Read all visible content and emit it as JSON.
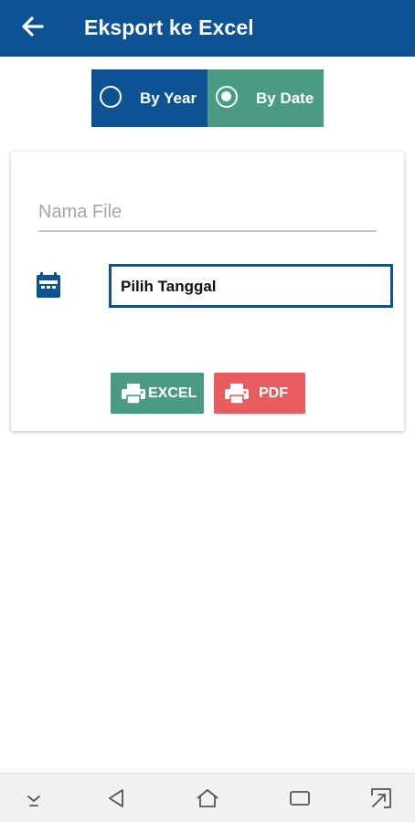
{
  "appbar": {
    "title": "Eksport ke Excel",
    "back_icon": "arrow-left-icon",
    "background": "#0d5394"
  },
  "mode_toggle": {
    "options": [
      {
        "label": "By Year",
        "selected": false
      },
      {
        "label": "By Date",
        "selected": true
      }
    ],
    "colors": {
      "unselected": "#0d5394",
      "selected": "#4a9b84"
    }
  },
  "form": {
    "filename": {
      "placeholder": "Nama File",
      "value": ""
    },
    "date": {
      "icon": "calendar-icon",
      "label": "Pilih Tanggal"
    },
    "buttons": {
      "excel": {
        "label": "EXCEL",
        "icon": "printer-icon",
        "color": "#4a9b84"
      },
      "pdf": {
        "label": "PDF",
        "icon": "printer-icon",
        "color": "#e85d5d"
      }
    }
  },
  "system_nav": {
    "icons": [
      "hide-keyboard-icon",
      "back-triangle-icon",
      "home-icon",
      "recents-icon",
      "screenshot-icon"
    ]
  }
}
